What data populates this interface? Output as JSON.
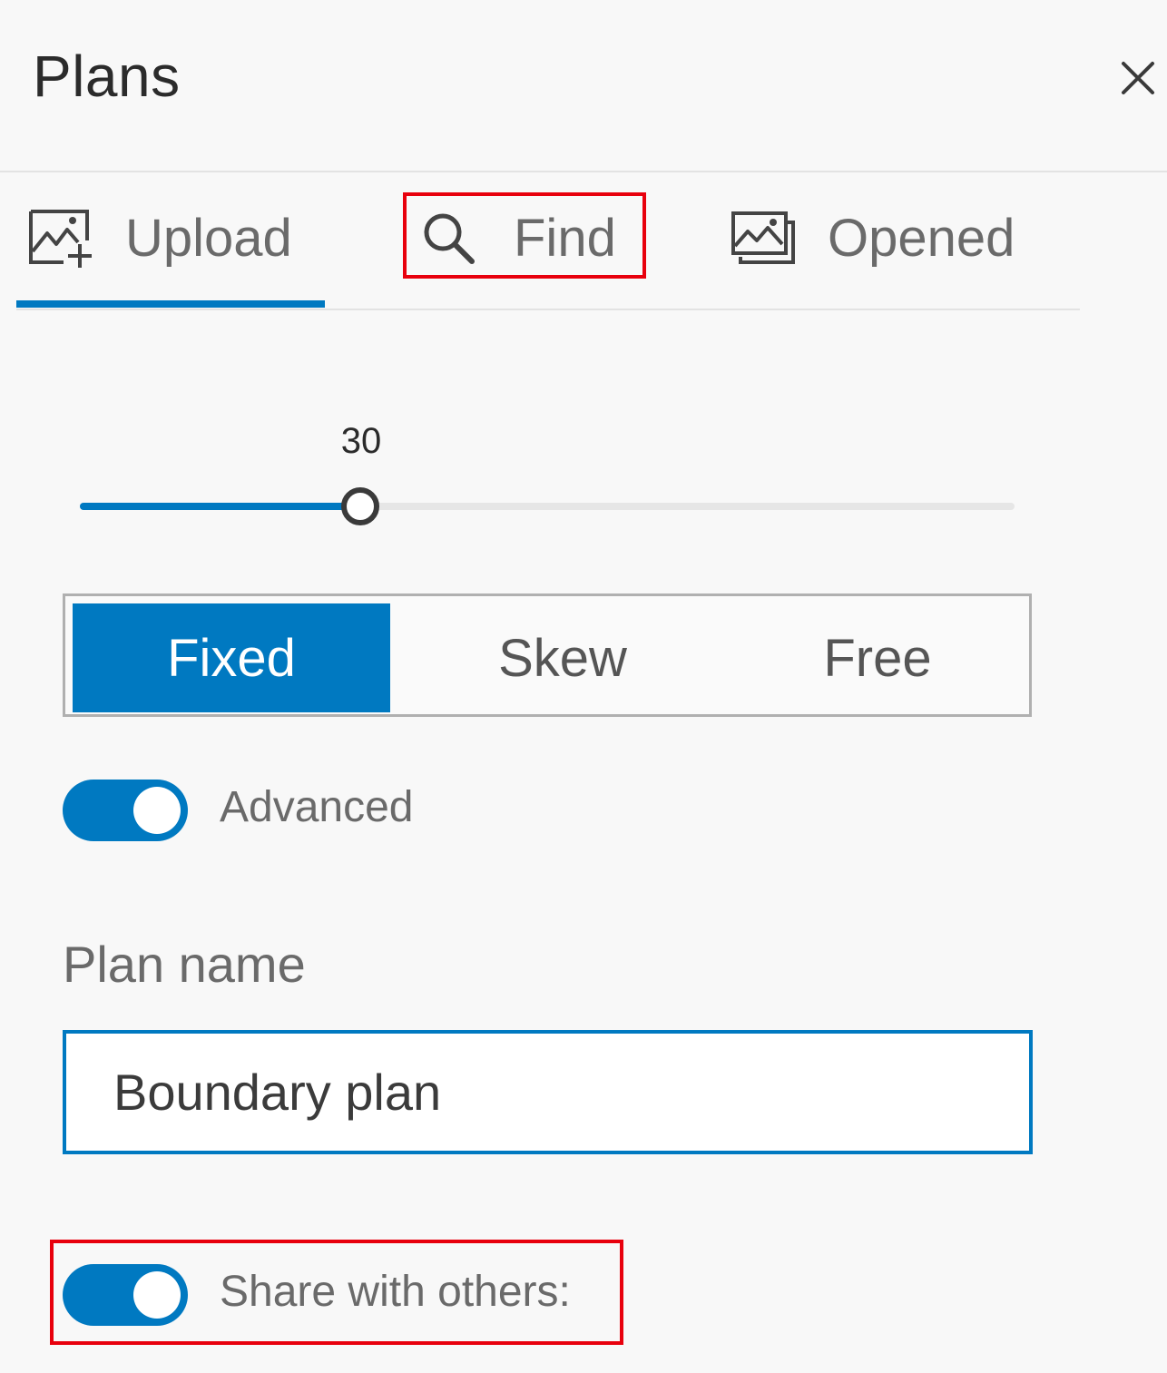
{
  "panel": {
    "title": "Plans",
    "close_icon": "close-icon"
  },
  "tabs": [
    {
      "label": "Upload",
      "icon": "image-add-icon",
      "active": true
    },
    {
      "label": "Find",
      "icon": "search-icon",
      "active": false
    },
    {
      "label": "Opened",
      "icon": "images-stack-icon",
      "active": false
    }
  ],
  "slider": {
    "value": "30",
    "level": 0.3,
    "min": 0,
    "max": 100
  },
  "mode_selector": {
    "options": [
      "Fixed",
      "Skew",
      "Free"
    ],
    "selected": "Fixed"
  },
  "advanced_toggle": {
    "label": "Advanced",
    "on": true
  },
  "plan_name": {
    "label": "Plan name",
    "value": "Boundary plan"
  },
  "share_toggle": {
    "label": "Share with others:",
    "on": true
  },
  "colors": {
    "accent": "#0079c1",
    "highlight": "#e8000d",
    "background": "#f8f8f8"
  }
}
